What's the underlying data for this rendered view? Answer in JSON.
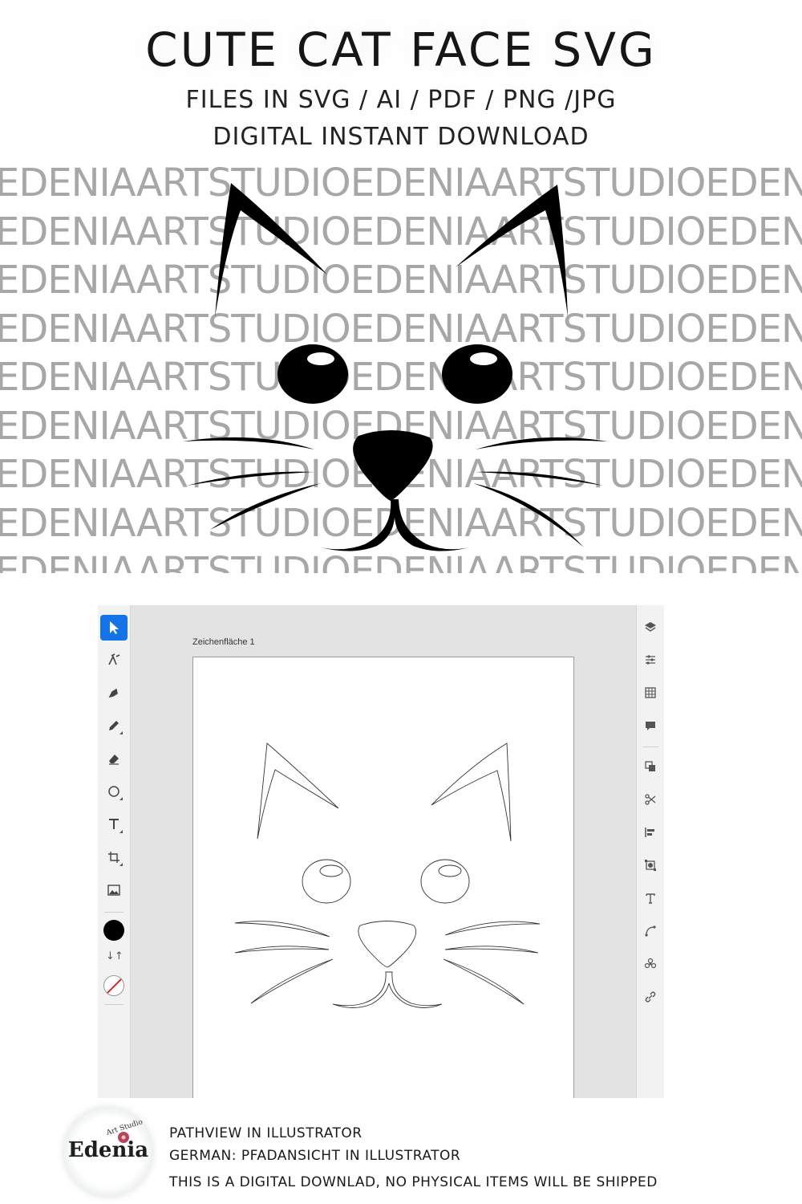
{
  "header": {
    "title": "CUTE CAT FACE SVG",
    "formats": "FILES IN SVG / AI / PDF / PNG /JPG",
    "delivery": "DIGITAL INSTANT DOWNLOAD"
  },
  "watermark": {
    "rows": [
      "EDENIAARTSTUDIOEDENIAARTSTUDIOEDENIAARTSTUDIO",
      "EDENIAARTSTUDIOEDENIAARTSTUDIOEDENIAARTSTUDIO",
      "EDENIAARTSTUDIOEDENIAARTSTUDIOEDENIAARTSTUDIO",
      "EDENIAARTSTUDIOEDENIAARTSTUDIOEDENIAARTSTUDIO",
      "EDENIAARTSTUDIOEDENIAARTSTUDIOEDENIAARTSTUDIO",
      "EDENIAARTSTUDIOEDENIAARTSTUDIOEDENIAARTSTUDIO",
      "EDENIAARTSTUDIOEDENIAARTSTUDIOEDENIAARTSTUDIO",
      "EDENIAARTSTUDIOEDENIAARTSTUDIOEDENIAARTSTUDIO",
      "EDENIAARTSTUDIOEDENIAARTSTUDIOEDENIAARTSTUDIO"
    ]
  },
  "illustrator": {
    "artboard_name": "Zeichenfläche 1",
    "tools": [
      "selection-tool",
      "direct-selection-tool",
      "pen-tool",
      "pencil-tool",
      "eraser-tool",
      "ellipse-tool",
      "type-tool",
      "transform-tool",
      "place-image-tool"
    ],
    "fill_color": "#000000",
    "stroke": "none",
    "accent": "#1473e6",
    "right_panels": [
      "layers-icon",
      "properties-icon",
      "swatches-icon",
      "comments-icon",
      "arrange-icon",
      "scissors-icon",
      "align-icon",
      "transform-icon",
      "type-icon",
      "path-icon",
      "repeat-icon",
      "link-icon"
    ]
  },
  "footer": {
    "logo_name": "Edenia",
    "logo_tag": "Art Studio",
    "line1": "PATHVIEW IN ILLUSTRATOR",
    "line2": "GERMAN: PFADANSICHT IN ILLUSTRATOR",
    "line3": "THIS IS A DIGITAL DOWNLAD, NO PHYSICAL ITEMS WILL BE SHIPPED"
  }
}
